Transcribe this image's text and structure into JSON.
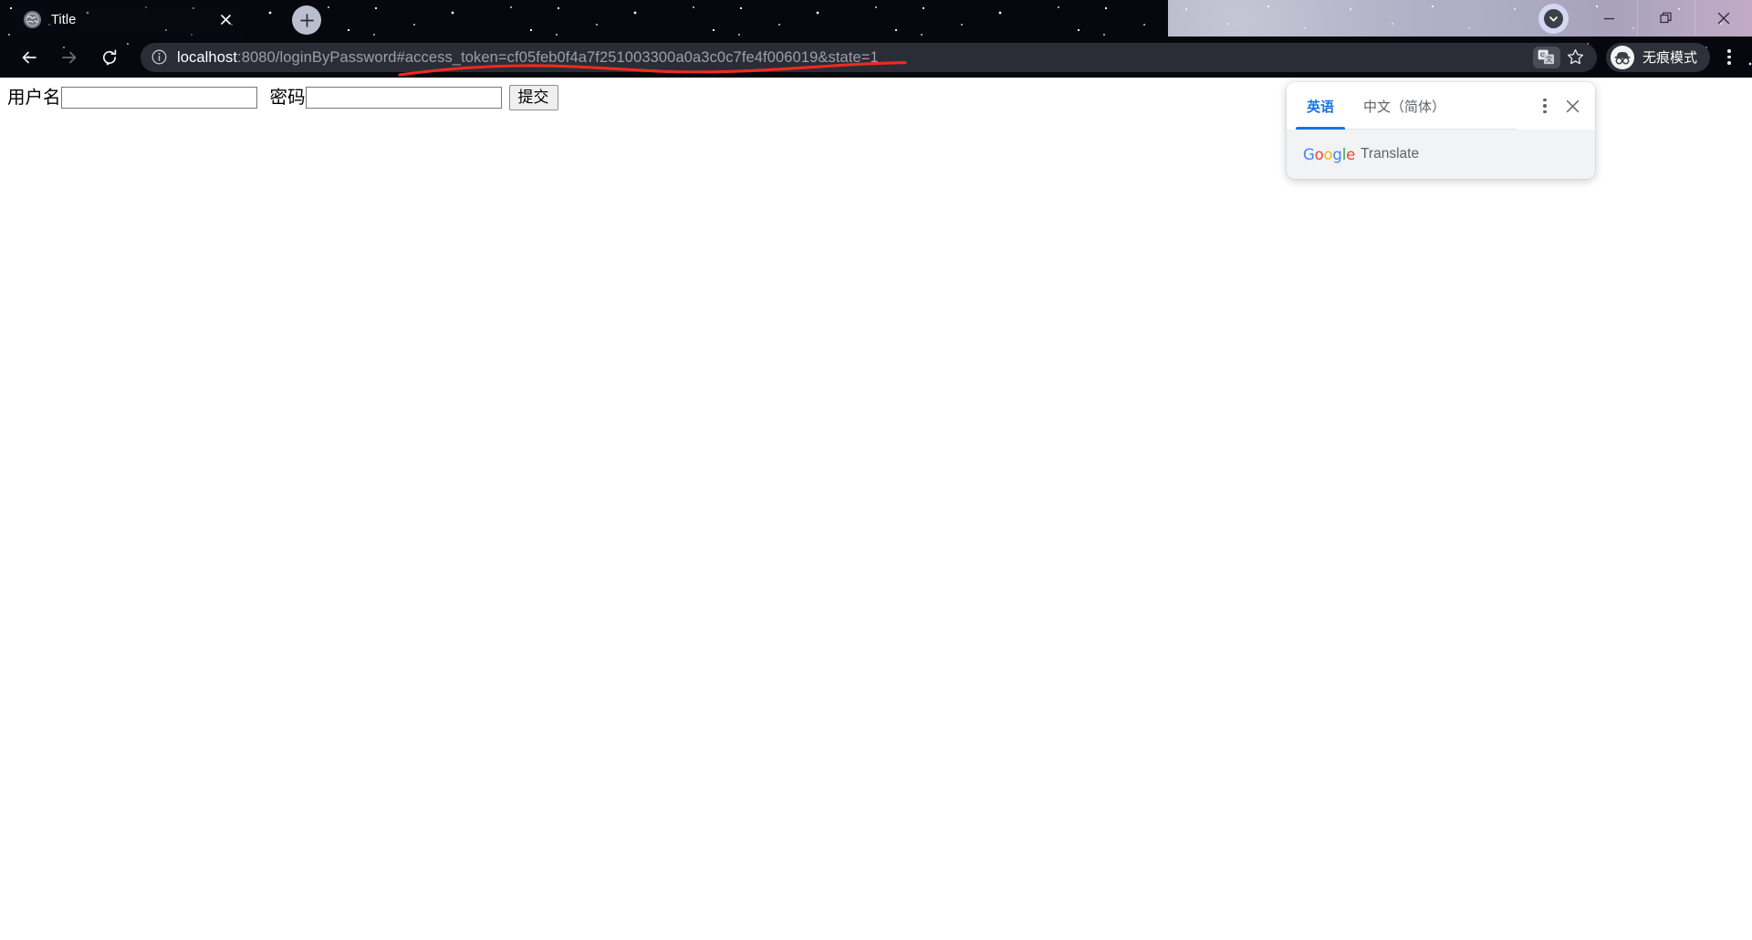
{
  "window": {
    "minimize_label": "minimize",
    "restore_label": "restore",
    "close_label": "close"
  },
  "tabstrip": {
    "tab": {
      "title": "Title",
      "favicon": "globe-icon",
      "close_label": "×"
    },
    "new_tab_label": "+",
    "profile_icon": "chevron-down-circle-icon"
  },
  "toolbar": {
    "back_label": "←",
    "forward_label": "→",
    "reload_label": "↻",
    "info_icon": "info-circle-icon",
    "url": {
      "host": "localhost",
      "rest": ":8080/loginByPassword#access_token=cf05feb0f4a7f251003300a0a3c0c7fe4f006019&state=1",
      "full": "localhost:8080/loginByPassword#access_token=cf05feb0f4a7f251003300a0a3c0c7fe4f006019&state=1"
    },
    "translate_icon": "translate-icon",
    "bookmark_icon": "star-icon",
    "incognito_label": "无痕模式",
    "incognito_icon": "incognito-hat-icon",
    "menu_icon": "kebab-menu-icon"
  },
  "annotation": {
    "type": "red-underline",
    "color": "#ef2a20"
  },
  "page": {
    "form": {
      "username_label": "用户名",
      "username_value": "",
      "username_placeholder": "",
      "password_label": "密码",
      "password_value": "",
      "password_placeholder": "",
      "submit_label": "提交"
    }
  },
  "translate_popup": {
    "tabs": [
      {
        "label": "英语",
        "active": true
      },
      {
        "label": "中文（简体）",
        "active": false
      }
    ],
    "options_icon": "kebab-menu-icon",
    "close_icon": "close-icon",
    "footer": {
      "brand_g": "G",
      "brand_o1": "o",
      "brand_o2": "o",
      "brand_g2": "g",
      "brand_l": "l",
      "brand_e": "e",
      "product": "Translate"
    },
    "accent_color": "#1a73e8"
  }
}
